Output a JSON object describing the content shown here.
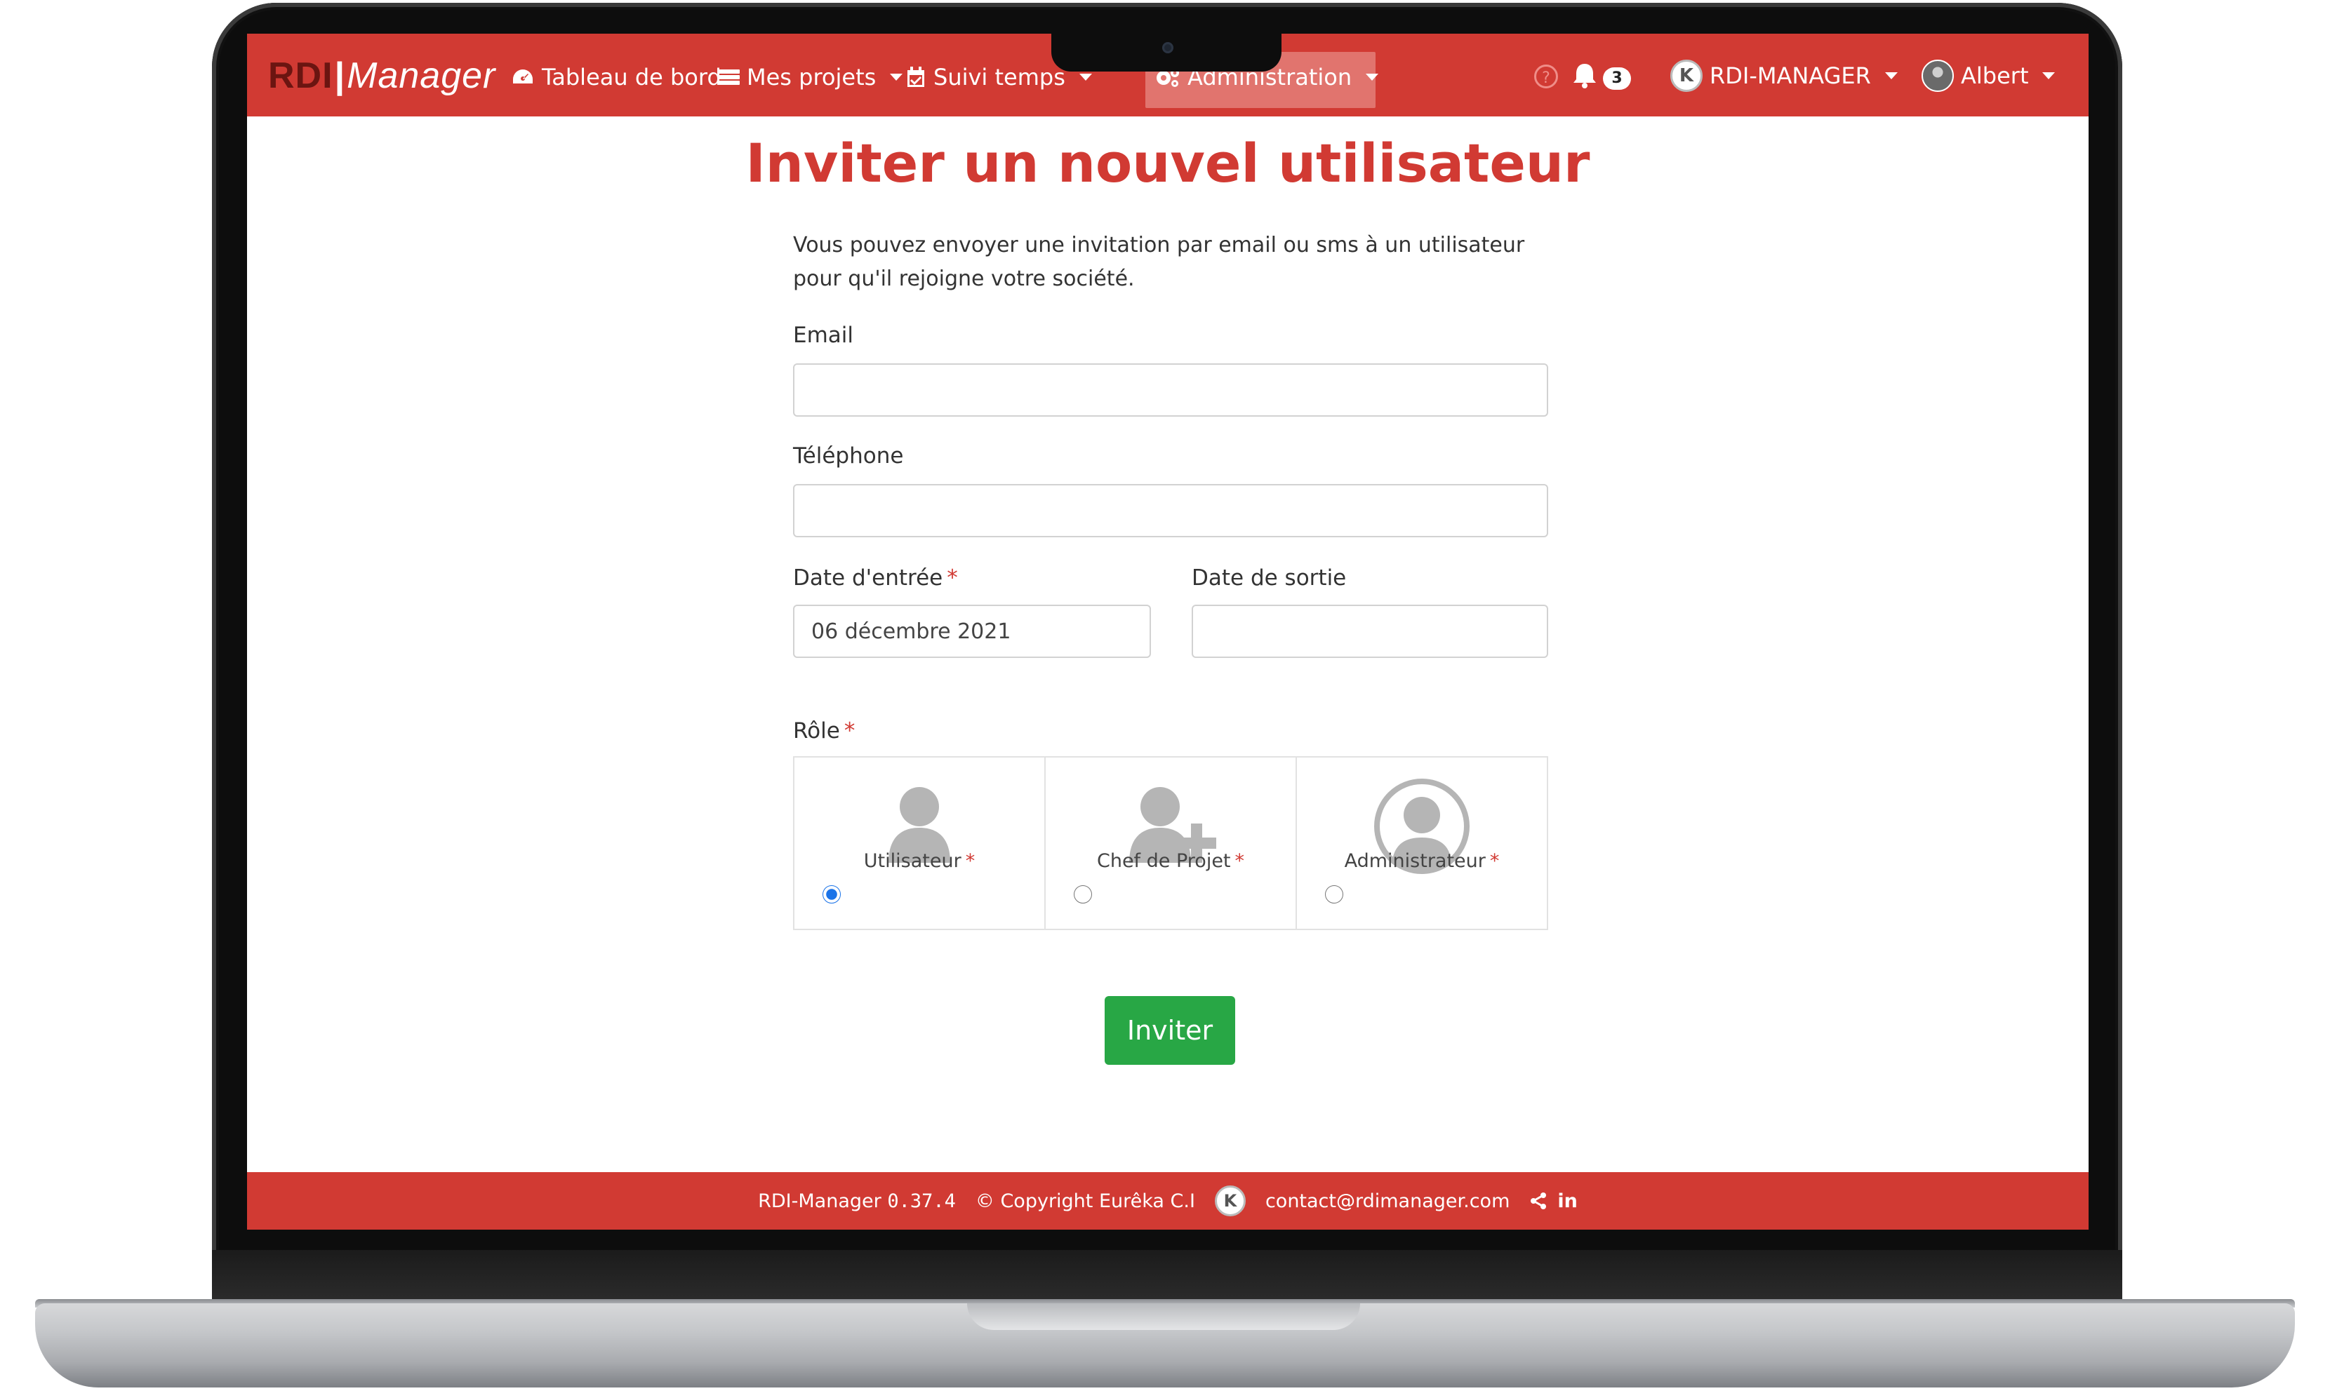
{
  "nav": {
    "logo_rdi": "RDI",
    "logo_manager": "Manager",
    "items": [
      {
        "label": "Tableau de bord",
        "icon": "dashboard-icon"
      },
      {
        "label": "Mes projets",
        "icon": "list-icon"
      },
      {
        "label": "Suivi temps",
        "icon": "calendar-check-icon"
      },
      {
        "label": "Administration",
        "icon": "cogs-icon"
      }
    ],
    "notification_count": "3",
    "company": "RDI-MANAGER",
    "user": "Albert"
  },
  "page": {
    "title": "Inviter un nouvel utilisateur",
    "intro": "Vous pouvez envoyer une invitation par email ou sms à un utilisateur pour qu'il rejoigne votre société."
  },
  "form": {
    "email_label": "Email",
    "email_value": "",
    "phone_label": "Téléphone",
    "phone_value": "",
    "entry_date_label": "Date d'entrée",
    "entry_date_value": "06 décembre 2021",
    "exit_date_label": "Date de sortie",
    "exit_date_value": "",
    "required_mark": "*",
    "role_label": "Rôle",
    "roles": [
      {
        "label": "Utilisateur",
        "icon": "user-icon",
        "selected": true
      },
      {
        "label": "Chef de Projet",
        "icon": "user-plus-icon",
        "selected": false
      },
      {
        "label": "Administrateur",
        "icon": "user-circle-icon",
        "selected": false
      }
    ],
    "submit_label": "Inviter"
  },
  "footer": {
    "app": "RDI-Manager",
    "version": "0.37.4",
    "copyright": "© Copyright Eurêka C.I",
    "email": "contact@rdimanager.com",
    "linkedin": "in"
  },
  "colors": {
    "brand_red": "#d13a33",
    "button_green": "#28a745",
    "radio_blue": "#1a73e8"
  }
}
